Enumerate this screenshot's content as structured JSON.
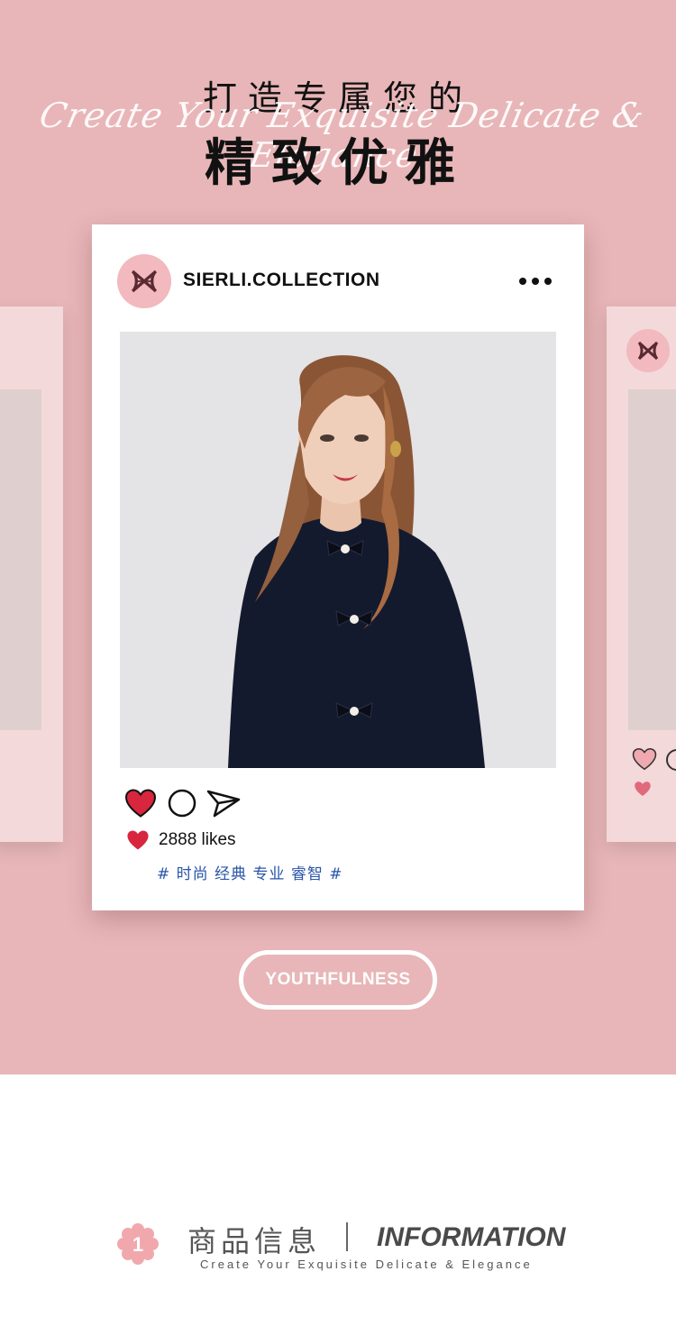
{
  "hero": {
    "title_line1": "打造专属您的",
    "script_text": "Create Your Exquisite Delicate & Elegance",
    "title_line2": "精致优雅"
  },
  "post": {
    "handle": "SIERLI.COLLECTION",
    "more_icon": "more-dots-icon",
    "actions": [
      "heart-icon",
      "comment-icon",
      "share-icon"
    ],
    "likes": "2888 likes",
    "tags": "# 时尚 经典 专业 睿智 #"
  },
  "pill": {
    "label": "YOUTHFULNESS"
  },
  "info": {
    "number": "1",
    "title_cn": "商品信息",
    "title_en": "INFORMATION",
    "subtitle": "Create Your Exquisite Delicate & Elegance"
  },
  "colors": {
    "background": "#e8b6b8",
    "ghost_card": "#f4d9da",
    "heart": "#d7263d",
    "tags": "#2a55a8",
    "avatar": "#f2b9be"
  }
}
